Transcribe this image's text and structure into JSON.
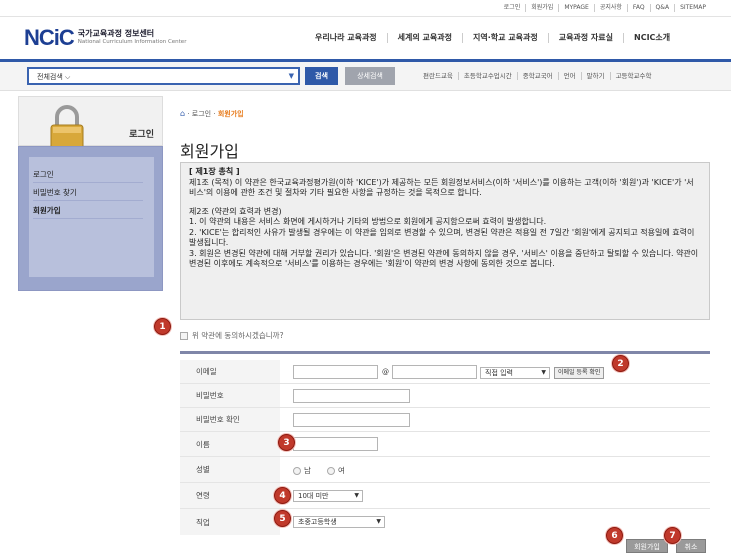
{
  "top_links": [
    "로그인",
    "회원가입",
    "MYPAGE",
    "공지사항",
    "FAQ",
    "Q&A",
    "SITEMAP"
  ],
  "logo": {
    "mark": "NCiC",
    "korean": "국가교육과정 정보센터",
    "english": "National Curriculum Information Center"
  },
  "gnb": [
    "우리나라 교육과정",
    "세계의 교육과정",
    "지역·학교 교육과정",
    "교육과정 자료실",
    "NCIC소개"
  ],
  "search": {
    "scope": "전체검색",
    "search_label": "검색",
    "detail_label": "상세검색"
  },
  "quick_links": [
    "편란드교육",
    "초등학교수업시간",
    "중학교국어",
    "언어",
    "말하기",
    "고등학교수학"
  ],
  "lnb": {
    "title": "로그인",
    "items": [
      "로그인",
      "비밀번호 찾기",
      "회원가입"
    ],
    "active_index": 2
  },
  "breadcrumb": {
    "home": "⌂",
    "sep1": "·",
    "login": "로그인",
    "sep2": "·",
    "current": "회원가입"
  },
  "page_title": "회원가입",
  "terms": {
    "chapter": "[ 제1장 총칙 ]",
    "art1": "제1조 (목적) 이 약관은 한국교육과정평가원(이하 'KICE')가 제공하는 모든 회원정보서비스(이하 '서비스')를 이용하는 고객(이하 '회원')과 'KICE'가 '서비스'의 이용에 관한 조건 및 절차와 기타 필요한 사항을 규정하는 것을 목적으로 합니다.",
    "art2_title": "제2조 (약관의 효력과 변경)",
    "art2_1": "1. 이 약관의 내용은 서비스 화면에 게시하거나 기타의 방법으로 회원에게 공지함으로써 효력이 발생합니다.",
    "art2_2": "2. 'KICE'는 합리적인 사유가 발생될 경우에는 이 약관을 임의로 변경할 수 있으며, 변경된 약관은 적용일 전 7일간 '회원'에게 공지되고 적용일에 효력이 발생됩니다.",
    "art2_3": "3. 회원은 변경된 약관에 대해 거부할 권리가 있습니다. '회원'은 변경된 약관에 동의하지 않을 경우, '서비스' 이용을 중단하고 탈퇴할 수 있습니다. 약관이 변경된 이후에도 계속적으로 '서비스'를 이용하는 경우에는 '회원'이 약관의 변경 사항에 동의한 것으로 봅니다."
  },
  "agree_label": "위 약관에 동의하시겠습니까?",
  "form": {
    "email_label": "이메일",
    "at": "@",
    "domain_select": "직접 입력",
    "email_check": "이메일 등록 확인",
    "password_label": "비밀번호",
    "password_confirm_label": "비밀번호 확인",
    "name_label": "이름",
    "gender_label": "성별",
    "gender_male": "남",
    "gender_female": "여",
    "age_label": "연령",
    "age_value": "10대 미만",
    "job_label": "직업",
    "job_value": "초중고등학생"
  },
  "buttons": {
    "join": "회원가입",
    "cancel": "취소"
  },
  "badges": [
    "1",
    "2",
    "3",
    "4",
    "5",
    "6",
    "7"
  ]
}
